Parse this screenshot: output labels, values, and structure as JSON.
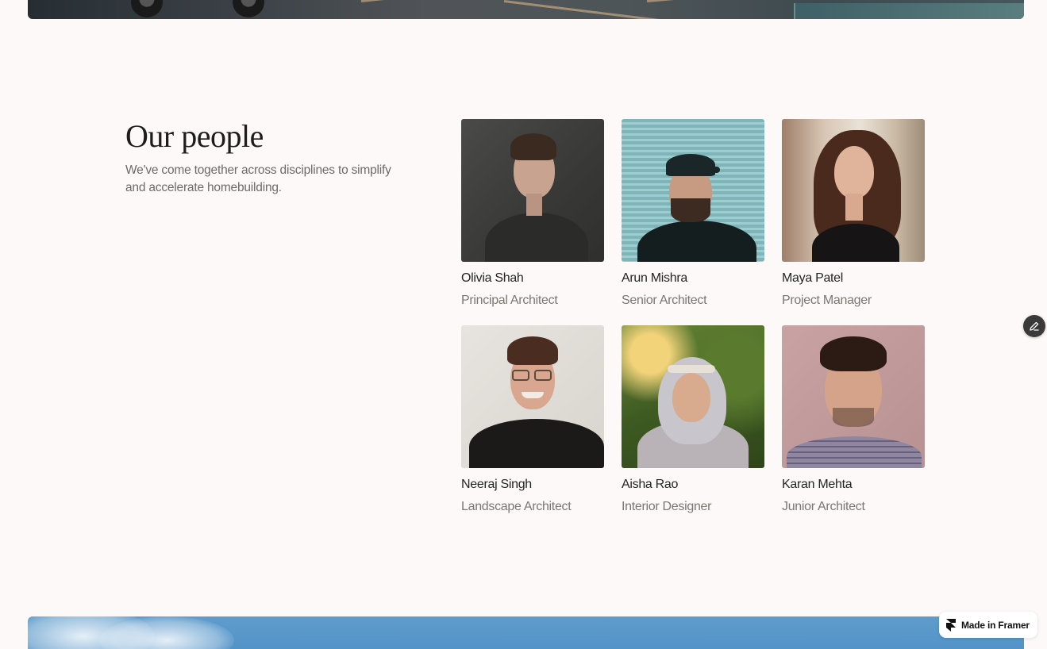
{
  "section": {
    "title": "Our people",
    "description": "We've come together across disciplines to simplify and accelerate homebuilding."
  },
  "people": [
    {
      "name": "Olivia Shah",
      "role": "Principal Architect"
    },
    {
      "name": "Arun Mishra",
      "role": "Senior Architect"
    },
    {
      "name": "Maya Patel",
      "role": "Project Manager"
    },
    {
      "name": "Neeraj Singh",
      "role": "Landscape Architect"
    },
    {
      "name": "Aisha Rao",
      "role": "Interior Designer"
    },
    {
      "name": "Karan Mehta",
      "role": "Junior Architect"
    }
  ],
  "badge": {
    "label": "Made in Framer",
    "icon": "framer-logo-icon"
  },
  "edit_button": {
    "icon": "pencil-icon"
  },
  "colors": {
    "page_background": "#fdf9f8",
    "heading": "#1d1d1d",
    "body_text": "#6d6a68",
    "name_text": "#242424",
    "role_text": "#7a7674"
  }
}
